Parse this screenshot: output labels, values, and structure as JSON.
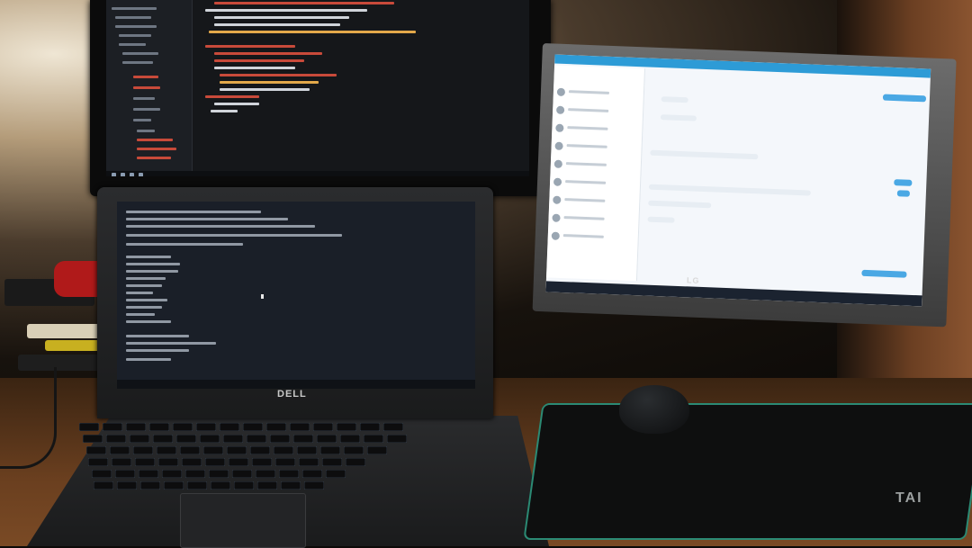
{
  "scene": "desk-setup",
  "brands": {
    "laptop": "DELL",
    "monitor": "LG",
    "mousepad": "TAI"
  },
  "colors": {
    "chat_accent": "#2d9bd6",
    "terminal_bg": "#1a1f28",
    "editor_bg": "#15171a",
    "mousepad_edge": "#2b8a74"
  },
  "icons": [
    "mouse-icon"
  ]
}
